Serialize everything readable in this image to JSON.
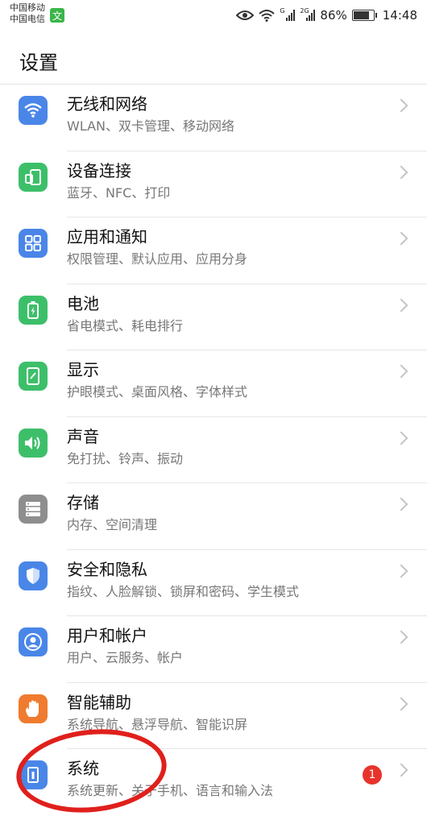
{
  "status_bar": {
    "carrier1": "中国移动",
    "carrier2": "中国电信",
    "carrier_badge": "文",
    "sig1_label": "G",
    "sig2_label": "2G",
    "battery": "86%",
    "battery_level": 0.86,
    "time": "14:48"
  },
  "header": {
    "title": "设置"
  },
  "items": [
    {
      "title": "无线和网络",
      "subtitle": "WLAN、双卡管理、移动网络",
      "icon": "wifi-icon",
      "color": "#4a86e8"
    },
    {
      "title": "设备连接",
      "subtitle": "蓝牙、NFC、打印",
      "icon": "device-connect-icon",
      "color": "#3dbf6a"
    },
    {
      "title": "应用和通知",
      "subtitle": "权限管理、默认应用、应用分身",
      "icon": "apps-icon",
      "color": "#4a86e8"
    },
    {
      "title": "电池",
      "subtitle": "省电模式、耗电排行",
      "icon": "battery-icon",
      "color": "#3dbf6a"
    },
    {
      "title": "显示",
      "subtitle": "护眼模式、桌面风格、字体样式",
      "icon": "display-icon",
      "color": "#3dbf6a"
    },
    {
      "title": "声音",
      "subtitle": "免打扰、铃声、振动",
      "icon": "sound-icon",
      "color": "#3dbf6a"
    },
    {
      "title": "存储",
      "subtitle": "内存、空间清理",
      "icon": "storage-icon",
      "color": "#8e8e8e"
    },
    {
      "title": "安全和隐私",
      "subtitle": "指纹、人脸解锁、锁屏和密码、学生模式",
      "icon": "shield-icon",
      "color": "#4a86e8"
    },
    {
      "title": "用户和帐户",
      "subtitle": "用户、云服务、帐户",
      "icon": "user-icon",
      "color": "#4a86e8"
    },
    {
      "title": "智能辅助",
      "subtitle": "系统导航、悬浮导航、智能识屏",
      "icon": "hand-icon",
      "color": "#f07b2e"
    },
    {
      "title": "系统",
      "subtitle": "系统更新、关于手机、语言和输入法",
      "icon": "system-icon",
      "color": "#4a86e8",
      "badge": "1"
    }
  ]
}
